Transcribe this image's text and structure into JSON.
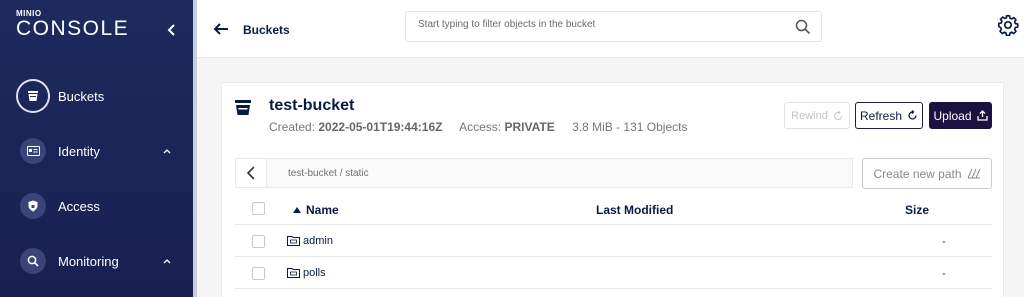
{
  "sidebar": {
    "logo_small": "MINIO",
    "logo_big": "CONSOLE",
    "items": [
      {
        "label": "Buckets"
      },
      {
        "label": "Identity"
      },
      {
        "label": "Access"
      },
      {
        "label": "Monitoring"
      }
    ]
  },
  "topbar": {
    "breadcrumb": "Buckets",
    "search_placeholder": "Start typing to filter objects in the bucket"
  },
  "bucket": {
    "name": "test-bucket",
    "created_label": "Created:",
    "created_value": "2022-05-01T19:44:16Z",
    "access_label": "Access:",
    "access_value": "PRIVATE",
    "stats": "3.8 MiB - 131 Objects"
  },
  "actions": {
    "rewind": "Rewind",
    "refresh": "Refresh",
    "upload": "Upload",
    "create_path": "Create new path"
  },
  "path": "test-bucket / static",
  "table": {
    "columns": {
      "name": "Name",
      "modified": "Last Modified",
      "size": "Size"
    },
    "rows": [
      {
        "name": "admin",
        "modified": "",
        "size": "-"
      },
      {
        "name": "polls",
        "modified": "",
        "size": "-"
      }
    ]
  },
  "colors": {
    "sidebar_bg": "#1e2a5e",
    "primary": "#081c42",
    "upload_bg": "#1c1240"
  }
}
